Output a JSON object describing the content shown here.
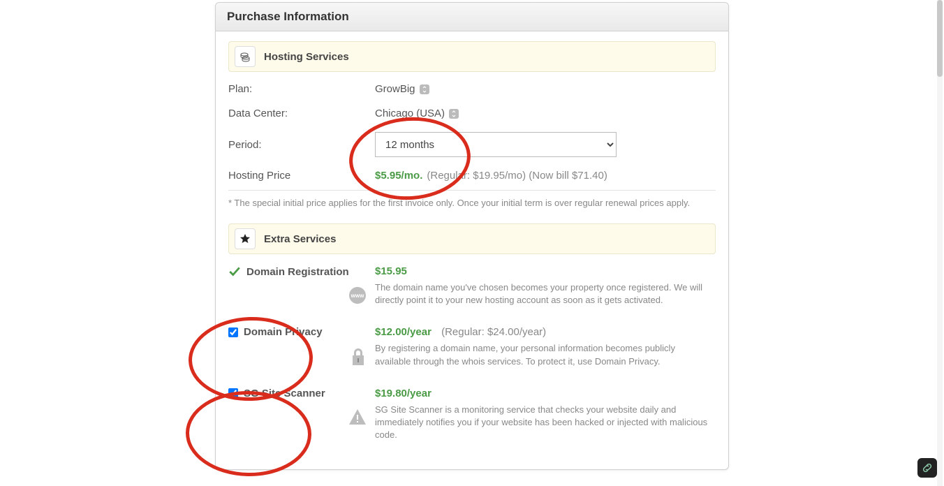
{
  "panel": {
    "title": "Purchase Information"
  },
  "hosting": {
    "section_title": "Hosting Services",
    "plan_label": "Plan:",
    "plan_value": "GrowBig",
    "dc_label": "Data Center:",
    "dc_value": "Chicago (USA)",
    "period_label": "Period:",
    "period_value": "12 months",
    "price_label": "Hosting Price",
    "price_special": "$5.95/mo.",
    "price_regular": "(Regular: $19.95/mo) (Now bill $71.40)",
    "footnote": "* The special initial price applies for the first invoice only. Once your initial term is over regular renewal prices apply."
  },
  "extras": {
    "section_title": "Extra Services",
    "domain_reg": {
      "label": "Domain Registration",
      "price": "$15.95",
      "desc": "The domain name you've chosen becomes your property once registered. We will directly point it to your new hosting account as soon as it gets activated."
    },
    "domain_privacy": {
      "label": "Domain Privacy",
      "price": "$12.00/year",
      "regular": "(Regular: $24.00/year)",
      "desc": "By registering a domain name, your personal information becomes publicly available through the whois services. To protect it, use Domain Privacy."
    },
    "site_scanner": {
      "label": "SG Site Scanner",
      "price": "$19.80/year",
      "desc": "SG Site Scanner is a monitoring service that checks your website daily and immediately notifies you if your website has been hacked or injected with malicious code."
    }
  }
}
